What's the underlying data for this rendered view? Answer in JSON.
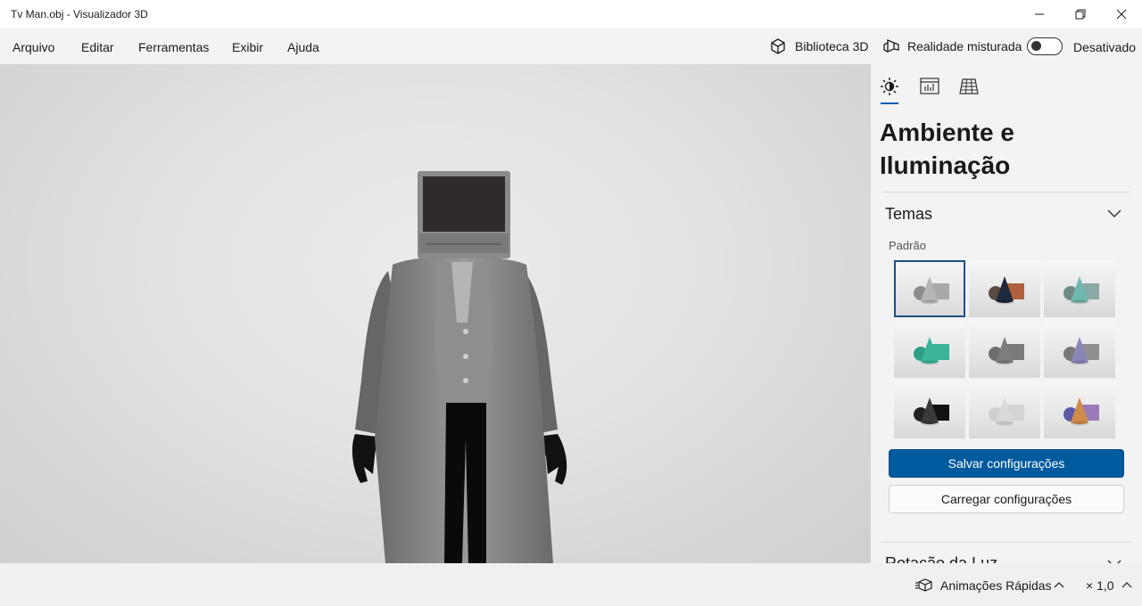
{
  "window": {
    "title": "Tv Man.obj - Visualizador 3D",
    "controls": [
      "minimize-icon",
      "restore-icon",
      "close-icon"
    ]
  },
  "menu": {
    "items": [
      "Arquivo",
      "Editar",
      "Ferramentas",
      "Exibir",
      "Ajuda"
    ],
    "library_label": "Biblioteca 3D",
    "mixed_reality_label": "Realidade misturada",
    "mixed_reality_state": "Desativado"
  },
  "panel": {
    "tabs": [
      {
        "icon": "sun-icon",
        "selected": true
      },
      {
        "icon": "stats-icon",
        "selected": false
      },
      {
        "icon": "grid-icon",
        "selected": false
      }
    ],
    "heading": "Ambiente e Iluminação",
    "themes_section": {
      "title": "Temas",
      "subheading": "Padrão",
      "selected_index": 0,
      "themes": [
        {
          "sphere": "#8d8d8d",
          "cone": "#b5b5b5",
          "box": "#a8a8a8"
        },
        {
          "sphere": "#5a4a44",
          "cone": "#1f2a3c",
          "box": "#b0603c"
        },
        {
          "sphere": "#6f8a86",
          "cone": "#6fb8ae",
          "box": "#8aa8a4"
        },
        {
          "sphere": "#2f9e86",
          "cone": "#3bb49a",
          "box": "#3bb49a"
        },
        {
          "sphere": "#6e6e6e",
          "cone": "#7d7d7d",
          "box": "#7a7a7a"
        },
        {
          "sphere": "#777777",
          "cone": "#8a86b8",
          "box": "#8f8f8f"
        },
        {
          "sphere": "#222222",
          "cone": "#3a3a3a",
          "box": "#111111"
        },
        {
          "sphere": "#cfcfcf",
          "cone": "#d9d9d9",
          "box": "#d4d4d4"
        },
        {
          "sphere": "#5a5aa8",
          "cone": "#d08a4a",
          "box": "#9a7ab8"
        }
      ]
    },
    "save_button": "Salvar configurações",
    "load_button": "Carregar configurações",
    "next_section": "Rotação da Luz"
  },
  "bottom": {
    "animations_label": "Animações Rápidas",
    "speed_label": "× 1,0"
  },
  "colors": {
    "accent": "#005fb8",
    "primary_button": "#005a9e"
  }
}
